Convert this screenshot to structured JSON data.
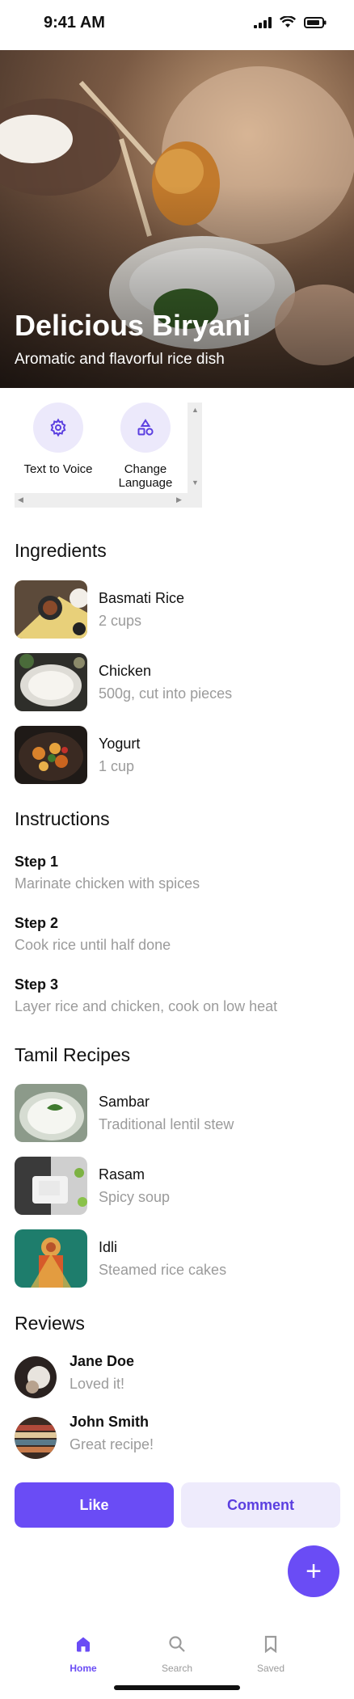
{
  "status": {
    "time": "9:41 AM"
  },
  "hero": {
    "title": "Delicious Biryani",
    "subtitle": "Aromatic and flavorful rice dish"
  },
  "actions": [
    {
      "label": "Text to Voice",
      "icon": "gear-icon"
    },
    {
      "label": "Change Language",
      "icon": "shapes-icon"
    }
  ],
  "ingredients": {
    "title": "Ingredients",
    "items": [
      {
        "name": "Basmati Rice",
        "amount": "2 cups"
      },
      {
        "name": "Chicken",
        "amount": "500g, cut into pieces"
      },
      {
        "name": "Yogurt",
        "amount": "1 cup"
      }
    ]
  },
  "instructions": {
    "title": "Instructions",
    "steps": [
      {
        "title": "Step 1",
        "text": "Marinate chicken with spices"
      },
      {
        "title": "Step 2",
        "text": "Cook rice until half done"
      },
      {
        "title": "Step 3",
        "text": "Layer rice and chicken, cook on low heat"
      }
    ]
  },
  "tamil_recipes": {
    "title": "Tamil Recipes",
    "items": [
      {
        "name": "Sambar",
        "desc": "Traditional lentil stew"
      },
      {
        "name": "Rasam",
        "desc": "Spicy soup"
      },
      {
        "name": "Idli",
        "desc": "Steamed rice cakes"
      }
    ]
  },
  "reviews": {
    "title": "Reviews",
    "items": [
      {
        "name": "Jane Doe",
        "text": "Loved it!"
      },
      {
        "name": "John Smith",
        "text": "Great recipe!"
      }
    ]
  },
  "buttons": {
    "like": "Like",
    "comment": "Comment"
  },
  "fab": {
    "label": "+"
  },
  "tabs": [
    {
      "label": "Home",
      "icon": "home-icon",
      "active": true
    },
    {
      "label": "Search",
      "icon": "search-icon",
      "active": false
    },
    {
      "label": "Saved",
      "icon": "bookmark-icon",
      "active": false
    }
  ],
  "colors": {
    "accent": "#6a4cf5",
    "accent_light": "#eeebfc",
    "muted_text": "#9b9b9b"
  }
}
